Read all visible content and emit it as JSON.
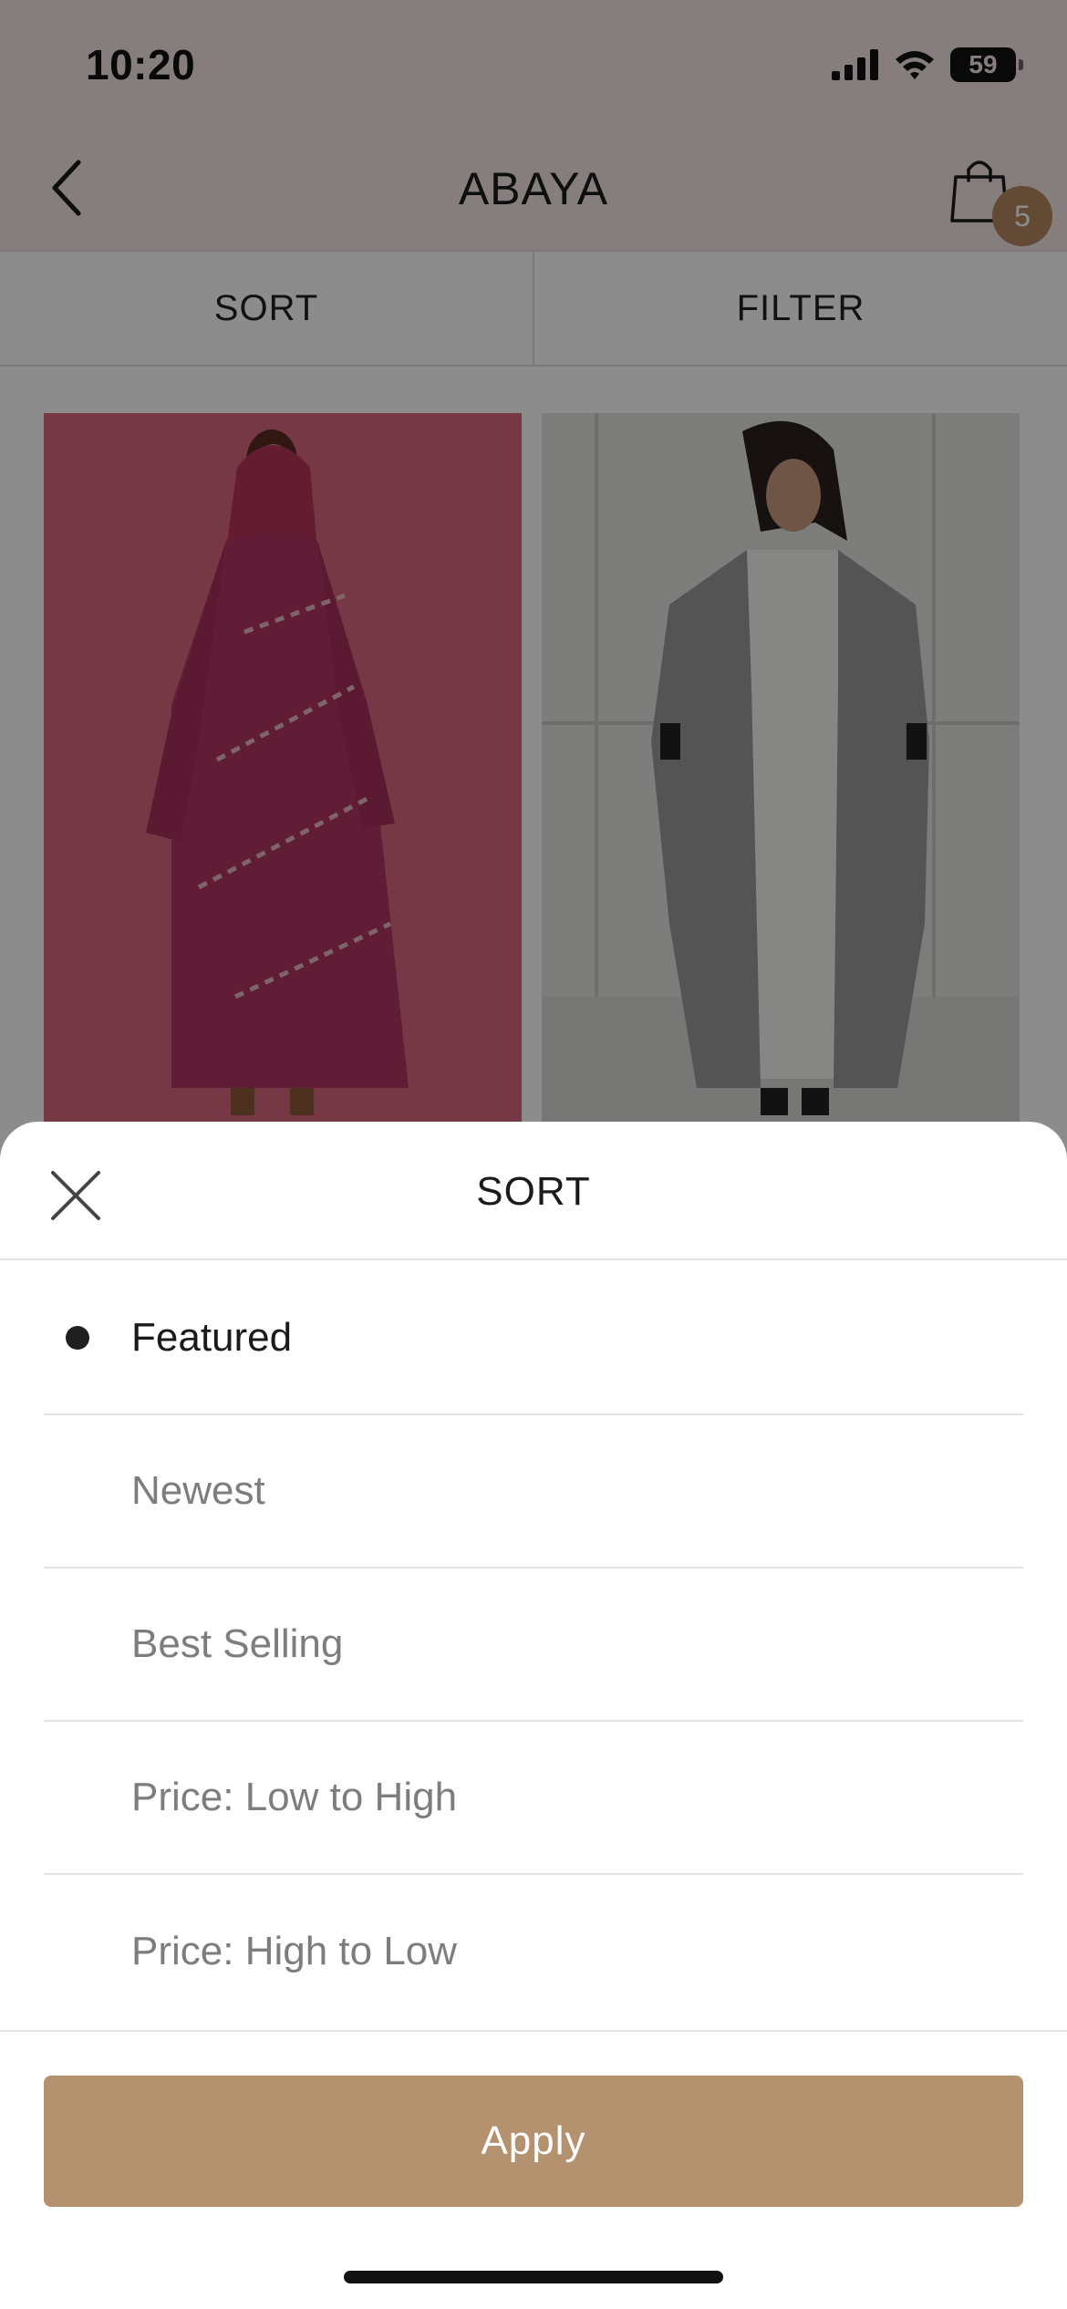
{
  "status_bar": {
    "time": "10:20",
    "battery": "59"
  },
  "nav": {
    "title": "ABAYA",
    "cart_count": "5"
  },
  "tabs": [
    {
      "label": "SORT"
    },
    {
      "label": "FILTER"
    }
  ],
  "sort_sheet": {
    "title": "SORT",
    "options": [
      {
        "label": "Featured",
        "selected": true
      },
      {
        "label": "Newest",
        "selected": false
      },
      {
        "label": "Best Selling",
        "selected": false
      },
      {
        "label": "Price: Low to High",
        "selected": false
      },
      {
        "label": "Price: High to Low",
        "selected": false
      }
    ],
    "apply_label": "Apply"
  },
  "colors": {
    "accent": "#b5926f",
    "badge": "#b28860",
    "header_bg": "#f3e6e3"
  }
}
